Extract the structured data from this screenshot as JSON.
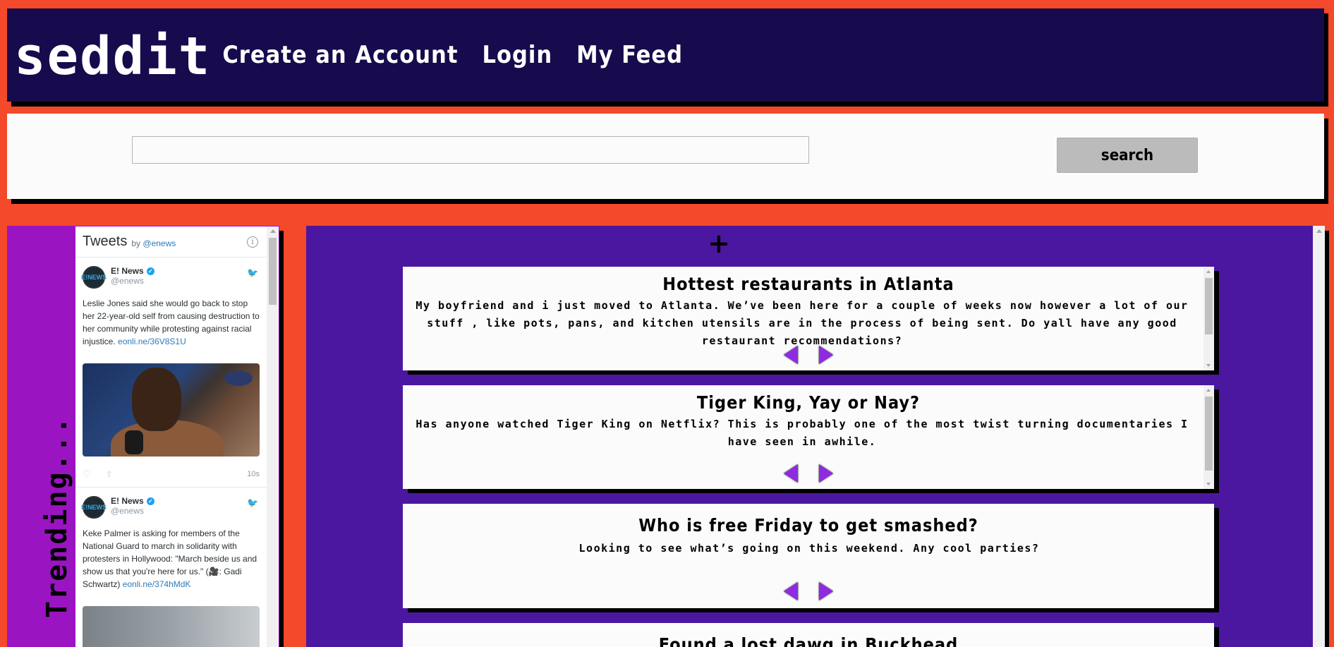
{
  "header": {
    "logo": "seddit",
    "nav": [
      "Create an Account",
      "Login",
      "My Feed"
    ]
  },
  "search": {
    "placeholder": "",
    "value": "",
    "button_label": "search"
  },
  "trending": {
    "label": "Trending...",
    "widget": {
      "title": "Tweets",
      "by": "by",
      "handle_link": "@enews",
      "info_icon": "info-icon",
      "tweets": [
        {
          "name": "E! News",
          "handle": "@enews",
          "avatar_text": "E!NEWS",
          "text": "Leslie Jones said she would go back to stop her 22-year-old self from causing destruction to her community while protesting against racial injustice.",
          "link": "eonli.ne/36V8S1U",
          "time": "10s"
        },
        {
          "name": "E! News",
          "handle": "@enews",
          "avatar_text": "E!NEWS",
          "text": "Keke Palmer is asking for members of the National Guard to march in solidarity with protesters in Hollywood: \"March beside us and show us that you're here for us.\" (🎥: Gadi Schwartz)",
          "link": "eonli.ne/374hMdK"
        }
      ]
    }
  },
  "feed": {
    "add_icon": "+",
    "posts": [
      {
        "title": "Hottest restaurants in Atlanta",
        "body": "My boyfriend and i just moved to Atlanta. We’ve been here for a couple of weeks now however a lot of our stuff , like pots, pans, and kitchen utensils are in the process of being sent. Do yall have any good restaurant recommendations?"
      },
      {
        "title": "Tiger King, Yay or Nay?",
        "body": "Has anyone watched Tiger King on Netflix? This is probably one of the most twist turning documentaries I have seen in awhile."
      },
      {
        "title": "Who is free Friday to get smashed?",
        "body": "Looking to see what’s going on this weekend. Any cool parties?"
      },
      {
        "title": "Found a lost dawg in Buckhead",
        "body": ""
      }
    ]
  },
  "colors": {
    "page_bg": "#f4492a",
    "header_bg": "#170b4d",
    "trending_bg": "#9b14c2",
    "feed_bg": "#4b17a0",
    "arrow": "#8f2ae0"
  }
}
